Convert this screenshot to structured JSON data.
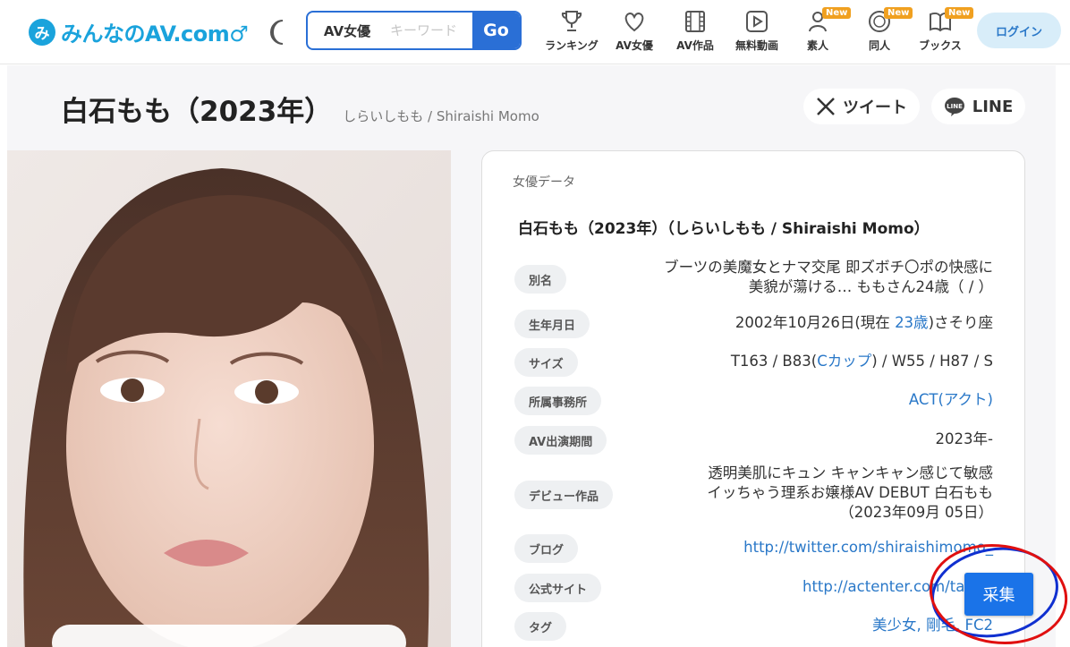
{
  "header": {
    "logo_badge": "み",
    "logo_text": "みんなのAV.com♂",
    "search": {
      "type_label": "AV女優",
      "placeholder": "キーワード",
      "go_label": "Go"
    },
    "nav": [
      {
        "label": "ランキング",
        "icon": "trophy-icon",
        "new": ""
      },
      {
        "label": "AV女優",
        "icon": "heart-icon",
        "new": ""
      },
      {
        "label": "AV作品",
        "icon": "film-icon",
        "new": ""
      },
      {
        "label": "無料動画",
        "icon": "play-icon",
        "new": ""
      },
      {
        "label": "素人",
        "icon": "amateur-icon",
        "new": "New"
      },
      {
        "label": "同人",
        "icon": "doujin-icon",
        "new": "New"
      },
      {
        "label": "ブックス",
        "icon": "book-icon",
        "new": "New"
      }
    ],
    "login_label": "ログイン"
  },
  "page": {
    "title": "白石もも（2023年）",
    "subtitle": "しらいしもも / Shiraishi Momo",
    "tweet_label": "ツイート",
    "line_label": "LINE"
  },
  "card": {
    "label": "女優データ",
    "name": "白石もも（2023年）（しらいしもも / Shiraishi Momo）",
    "rows": [
      {
        "label": "別名",
        "value_lines": [
          "ブーツの美魔女とナマ交尾 即ズボチ〇ポの快感に",
          "美貌が蕩ける… ももさん24歳（ / ）"
        ]
      },
      {
        "label": "生年月日",
        "value_pre": "2002年10月26日(現在 ",
        "value_link": "23歳",
        "value_post": ")さそり座"
      },
      {
        "label": "サイズ",
        "value_pre": "T163 / B83(",
        "value_link": "Cカップ",
        "value_post": ") / W55 / H87 / S"
      },
      {
        "label": "所属事務所",
        "value_link": "ACT(アクト)"
      },
      {
        "label": "AV出演期間",
        "value": "2023年-"
      },
      {
        "label": "デビュー作品",
        "value_lines": [
          "透明美肌にキュン キャンキャン感じて敏感",
          "イッちゃう理系お嬢様AV DEBUT 白石もも",
          "（2023年09月 05日）"
        ]
      },
      {
        "label": "ブログ",
        "value_link": "http://twitter.com/shiraishimomo_"
      },
      {
        "label": "公式サイト",
        "value_link": "http://actenter.com/talent"
      },
      {
        "label": "タグ",
        "value_link": "美少女, 剛毛, FC2"
      }
    ]
  },
  "collect_label": "采集",
  "colors": {
    "accent": "#1aa3dc",
    "search_blue": "#2a6fd6",
    "link": "#2a78c8",
    "new_badge": "#f0a020",
    "collect": "#1a73e8",
    "mark_red": "#e01010",
    "mark_blue": "#1030d0"
  }
}
